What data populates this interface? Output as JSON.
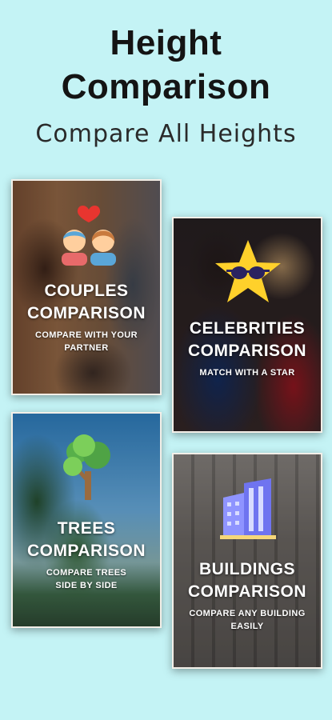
{
  "header": {
    "title": "Height\nComparison",
    "subtitle": "Compare All Heights"
  },
  "cards": [
    {
      "title": "COUPLES\nCOMPARISON",
      "subtitle": "COMPARE WITH YOUR\nPARTNER",
      "icon": "couple-heart-icon"
    },
    {
      "title": "CELEBRITIES\nCOMPARISON",
      "subtitle": "MATCH WITH A STAR",
      "icon": "star-sunglasses-icon"
    },
    {
      "title": "TREES\nCOMPARISON",
      "subtitle": "COMPARE TREES\nSIDE BY SIDE",
      "icon": "tree-icon"
    },
    {
      "title": "BUILDINGS\nCOMPARISON",
      "subtitle": "COMPARE ANY BUILDING\nEASILY",
      "icon": "buildings-icon"
    }
  ],
  "colors": {
    "background": "#c4f3f5",
    "heart": "#e8352f",
    "star": "#ffd12b",
    "tree": "#7ccf5a",
    "building": "#6f74f0"
  }
}
